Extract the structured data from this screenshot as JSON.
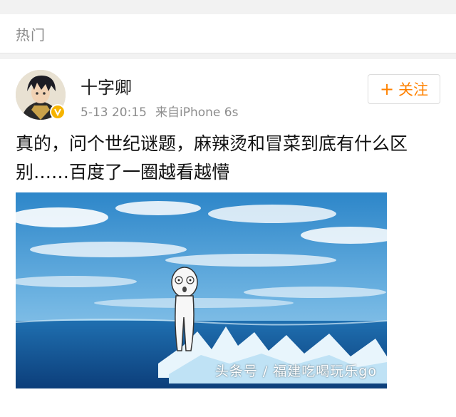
{
  "section": {
    "title": "热门"
  },
  "post": {
    "user": {
      "name": "十字卿",
      "verified": true
    },
    "time": "5-13 20:15",
    "source": "来自iPhone 6s",
    "follow_label": "关注",
    "text": "真的，问个世纪谜题，麻辣烫和冒菜到底有什么区别……百度了一圈越看越懵"
  },
  "watermark": "头条号 / 福建吃喝玩乐go",
  "colors": {
    "accent": "#ff8200",
    "verified_badge": "#f6b400"
  }
}
